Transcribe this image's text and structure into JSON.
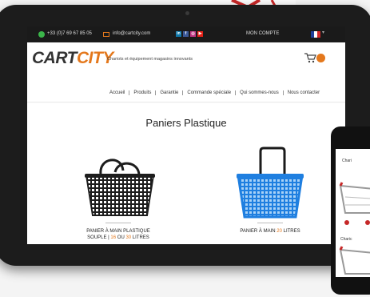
{
  "topbar": {
    "phone": "+33 (0)7 69 67 85 05",
    "email": "info@cartcity.com",
    "social": [
      "in",
      "f",
      "◎",
      "▶"
    ],
    "account": "MON COMPTE",
    "flag_colors": [
      "#1f3f9a",
      "#ffffff",
      "#d62828"
    ]
  },
  "header": {
    "logo_main": "CART",
    "logo_accent": "CITY",
    "tagline": "Chariots et équipement magasins innovants"
  },
  "nav": {
    "items": [
      "Accueil",
      "Produits",
      "Garantie",
      "Commande spéciale",
      "Qui sommes-nous",
      "Nous contacter"
    ]
  },
  "main": {
    "title": "Paniers Plastique",
    "products": [
      {
        "line1": "PANIER À MAIN PLASTIQUE",
        "line2_pre": "SOUPLE | ",
        "line2_hl1": "16",
        "line2_mid": " OU ",
        "line2_hl2": "30",
        "line2_post": " LITRES"
      },
      {
        "line1_pre": "PANIER À MAIN ",
        "line1_hl": "20",
        "line1_post": " LITRES"
      }
    ]
  },
  "phone": {
    "title": "Chari",
    "caption": "Charic"
  },
  "colors": {
    "accent": "#e4781c",
    "basket_blue": "#1f7fe0",
    "basket_black": "#1d1d1d"
  }
}
